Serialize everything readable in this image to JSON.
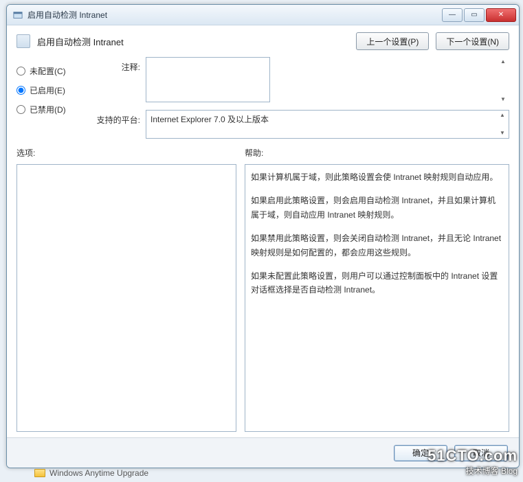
{
  "window": {
    "title": "启用自动检测 Intranet"
  },
  "header": {
    "setting_title": "启用自动检测 Intranet",
    "prev_btn": "上一个设置(P)",
    "next_btn": "下一个设置(N)"
  },
  "radios": {
    "not_configured": "未配置(C)",
    "enabled": "已启用(E)",
    "disabled": "已禁用(D)",
    "selected": "enabled"
  },
  "labels": {
    "comment": "注释:",
    "platform": "支持的平台:",
    "options": "选项:",
    "help": "帮助:"
  },
  "fields": {
    "comment_value": "",
    "platform_value": "Internet Explorer 7.0 及以上版本"
  },
  "help_paragraphs": [
    "如果计算机属于域，则此策略设置会使 Intranet 映射规则自动应用。",
    "如果启用此策略设置，则会启用自动检测 Intranet，并且如果计算机属于域，则自动应用 Intranet 映射规则。",
    "如果禁用此策略设置，则会关闭自动检测 Intranet，并且无论 Intranet 映射规则是如何配置的，都会应用这些规则。",
    "如果未配置此策略设置，则用户可以通过控制面板中的 Intranet 设置对话框选择是否自动检测 Intranet。"
  ],
  "footer": {
    "ok": "确定",
    "cancel": "取消"
  },
  "taskbar": {
    "item": "Windows Anytime Upgrade"
  },
  "watermark": {
    "main": "51CTO.com",
    "sub": "技术博客   Blog"
  }
}
